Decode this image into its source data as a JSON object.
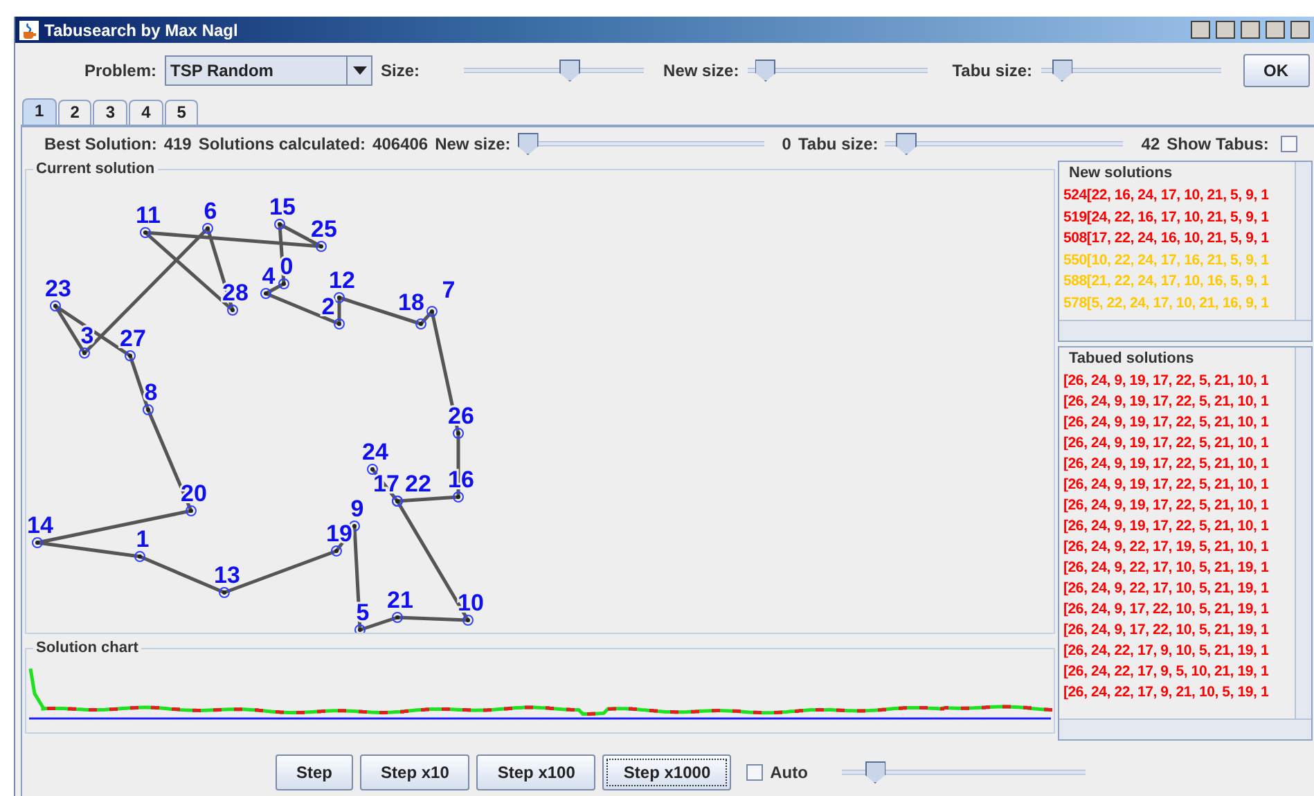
{
  "window": {
    "title": "Tabusearch by Max Nagl"
  },
  "toolbar": {
    "problem_label": "Problem:",
    "problem_value": "TSP Random",
    "size": {
      "label": "Size:",
      "level": 0.6
    },
    "new_size": {
      "label": "New size:",
      "level": 0.05
    },
    "tabu_size": {
      "label": "Tabu size:",
      "level": 0.07
    },
    "ok": "OK"
  },
  "tabs": [
    {
      "label": "1",
      "selected": true
    },
    {
      "label": "2",
      "selected": false
    },
    {
      "label": "3",
      "selected": false
    },
    {
      "label": "4",
      "selected": false
    },
    {
      "label": "5",
      "selected": false
    }
  ],
  "stats": {
    "best_label": "Best Solution:",
    "best_value": "419",
    "calc_label": "Solutions calculated:",
    "calc_value": "406406",
    "new_size": {
      "label": "New size:",
      "level": 0.0,
      "value": "0"
    },
    "tabu_size": {
      "label": "Tabu size:",
      "level": 0.05,
      "value": "42"
    },
    "show_tabus_label": "Show Tabus:",
    "show_tabus": false
  },
  "current_solution": {
    "title": "Current solution",
    "cities": [
      {
        "label": "6"
      },
      {
        "label": "15"
      },
      {
        "label": "11"
      },
      {
        "label": "25"
      },
      {
        "label": "0"
      },
      {
        "label": "4"
      },
      {
        "label": "12"
      },
      {
        "label": "23"
      },
      {
        "label": "28"
      },
      {
        "label": "7"
      },
      {
        "label": "2"
      },
      {
        "label": "18"
      },
      {
        "label": "3"
      },
      {
        "label": "27"
      },
      {
        "label": "8"
      },
      {
        "label": "26"
      },
      {
        "label": "24"
      },
      {
        "label": "17"
      },
      {
        "label": "22"
      },
      {
        "label": "16"
      },
      {
        "label": "20"
      },
      {
        "label": "9"
      },
      {
        "label": "14"
      },
      {
        "label": "1"
      },
      {
        "label": "19"
      },
      {
        "label": "13"
      },
      {
        "label": "21"
      },
      {
        "label": "10"
      },
      {
        "label": "5"
      }
    ]
  },
  "solution_chart": {
    "title": "Solution chart"
  },
  "new_solutions": {
    "title": "New solutions",
    "items": [
      {
        "text": "524[22, 16, 24, 17, 10, 21, 5, 9, 1",
        "color": "#ff0000"
      },
      {
        "text": "519[24, 22, 16, 17, 10, 21, 5, 9, 1",
        "color": "#ff0000"
      },
      {
        "text": "508[17, 22, 24, 16, 10, 21, 5, 9, 1",
        "color": "#ff0000"
      },
      {
        "text": "550[10, 22, 24, 17, 16, 21, 5, 9, 1",
        "color": "#ffc800"
      },
      {
        "text": "588[21, 22, 24, 17, 10, 16, 5, 9, 1",
        "color": "#ffc800"
      },
      {
        "text": "578[5, 22, 24, 17, 10, 21, 16, 9, 1",
        "color": "#ffc800"
      }
    ]
  },
  "tabued_solutions": {
    "title": "Tabued solutions",
    "items": [
      "[26, 24, 9, 19, 17, 22, 5, 21, 10, 1",
      "[26, 24, 9, 19, 17, 22, 5, 21, 10, 1",
      "[26, 24, 9, 19, 17, 22, 5, 21, 10, 1",
      "[26, 24, 9, 19, 17, 22, 5, 21, 10, 1",
      "[26, 24, 9, 19, 17, 22, 5, 21, 10, 1",
      "[26, 24, 9, 19, 17, 22, 5, 21, 10, 1",
      "[26, 24, 9, 19, 17, 22, 5, 21, 10, 1",
      "[26, 24, 9, 19, 17, 22, 5, 21, 10, 1",
      "[26, 24, 9, 22, 17, 19, 5, 21, 10, 1",
      "[26, 24, 9, 22, 17, 10, 5, 21, 19, 1",
      "[26, 24, 9, 22, 17, 10, 5, 21, 19, 1",
      "[26, 24, 9, 17, 22, 10, 5, 21, 19, 1",
      "[26, 24, 9, 17, 22, 10, 5, 21, 19, 1",
      "[26, 24, 22, 17, 9, 10, 5, 21, 19, 1",
      "[26, 24, 22, 17, 9, 5, 10, 21, 19, 1",
      "[26, 24, 22, 17, 9, 21, 10, 5, 19, 1"
    ]
  },
  "bottom": {
    "buttons": [
      {
        "label": "Step",
        "focused": false
      },
      {
        "label": "Step x10",
        "focused": false
      },
      {
        "label": "Step x100",
        "focused": false
      },
      {
        "label": "Step x1000",
        "focused": true
      }
    ],
    "auto_label": "Auto",
    "auto": false,
    "speed": {
      "level": 0.1
    }
  }
}
